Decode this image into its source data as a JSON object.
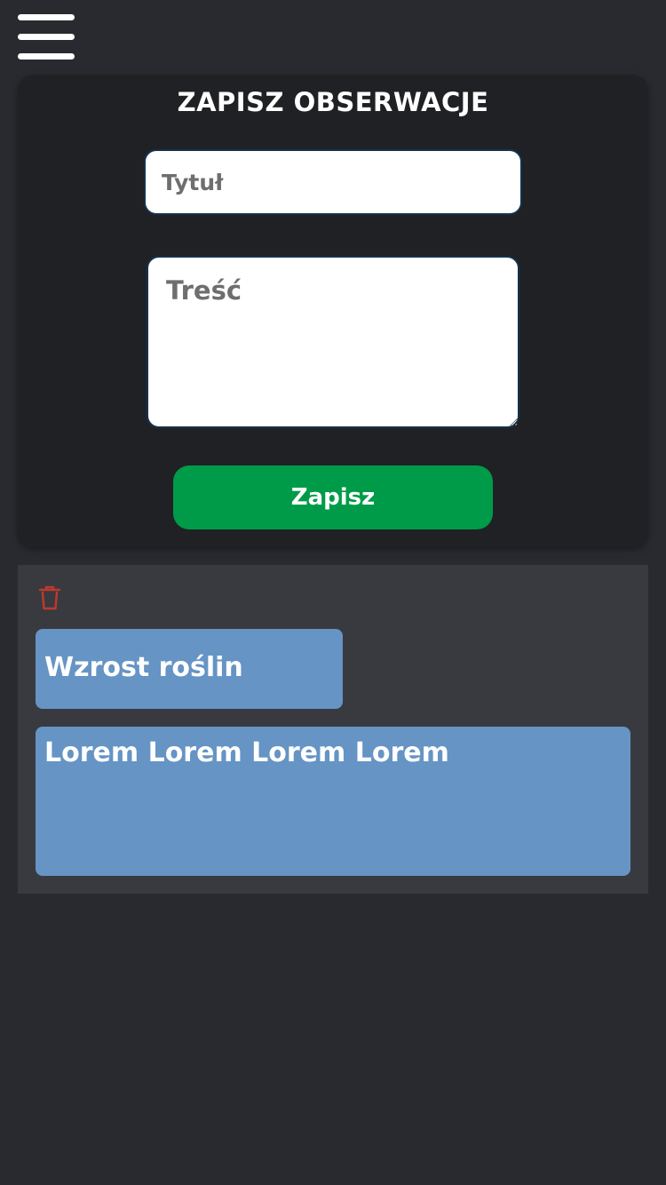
{
  "header": {
    "menu_icon": "hamburger-menu-icon"
  },
  "form": {
    "title": "ZAPISZ OBSERWACJE",
    "title_placeholder": "Tytuł",
    "content_placeholder": "Treść",
    "save_label": "Zapisz",
    "save_color": "#009b48"
  },
  "note": {
    "delete_icon": "trash-icon",
    "delete_color": "#c0392b",
    "title": "Wzrost roślin",
    "body": "Lorem Lorem Lorem Lorem",
    "note_color": "#6594c5"
  }
}
